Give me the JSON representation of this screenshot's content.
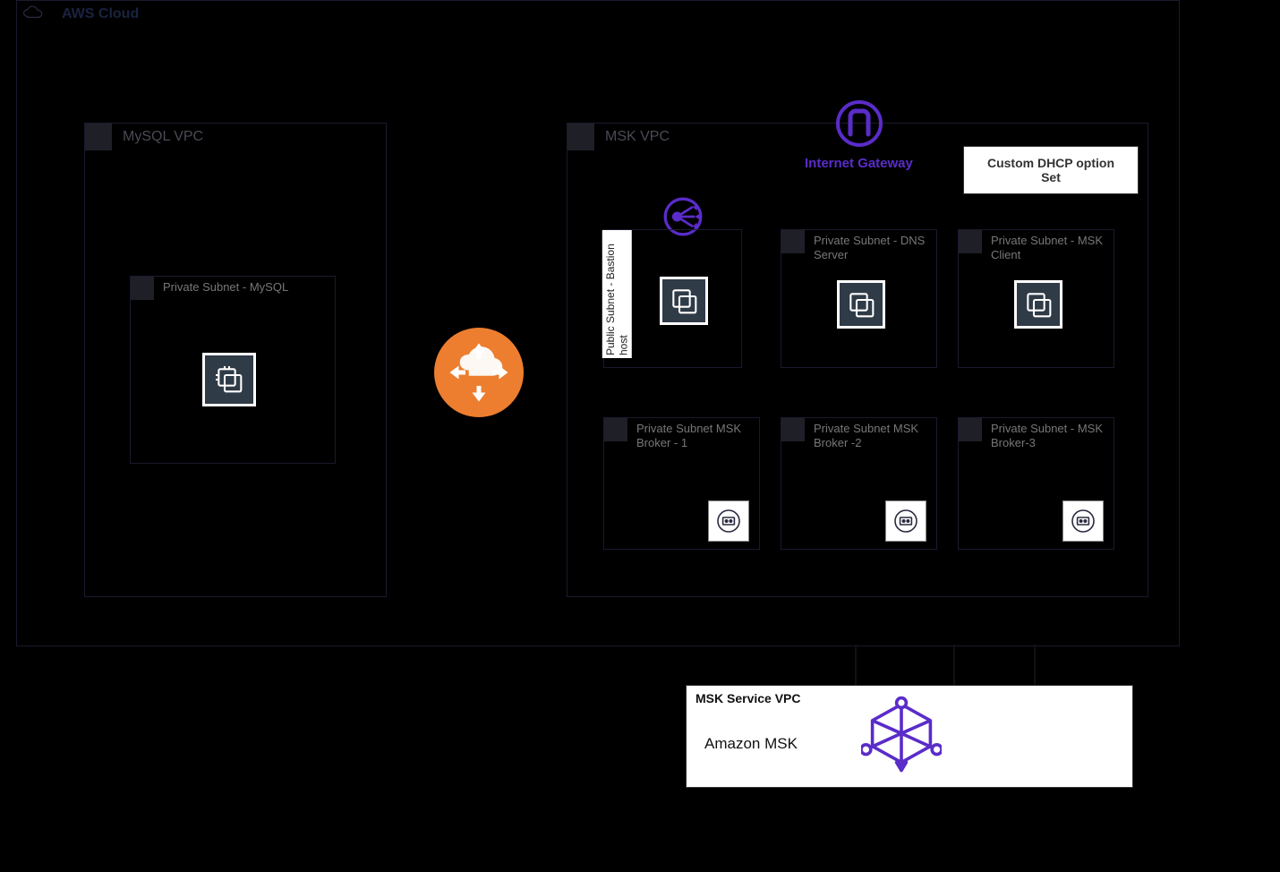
{
  "cloud": {
    "title": "AWS Cloud"
  },
  "vpc_mysql": {
    "title": "MySQL VPC",
    "subnet": {
      "title": "Private Subnet - MySQL"
    }
  },
  "vpc_msk": {
    "title": "MSK VPC",
    "igw_label": "Internet Gateway",
    "dhcp_label": "Custom DHCP option Set",
    "subnets": {
      "bastion": {
        "title": "Public Subnet - Bastion host"
      },
      "dns": {
        "title": "Private Subnet - DNS Server"
      },
      "client": {
        "title": "Private Subnet - MSK Client"
      },
      "broker1": {
        "title": "Private Subnet MSK Broker - 1"
      },
      "broker2": {
        "title": "Private Subnet MSK Broker -2"
      },
      "broker3": {
        "title": "Private Subnet - MSK Broker-3"
      }
    }
  },
  "msk_service": {
    "title": "MSK Service VPC",
    "product": "Amazon MSK"
  }
}
